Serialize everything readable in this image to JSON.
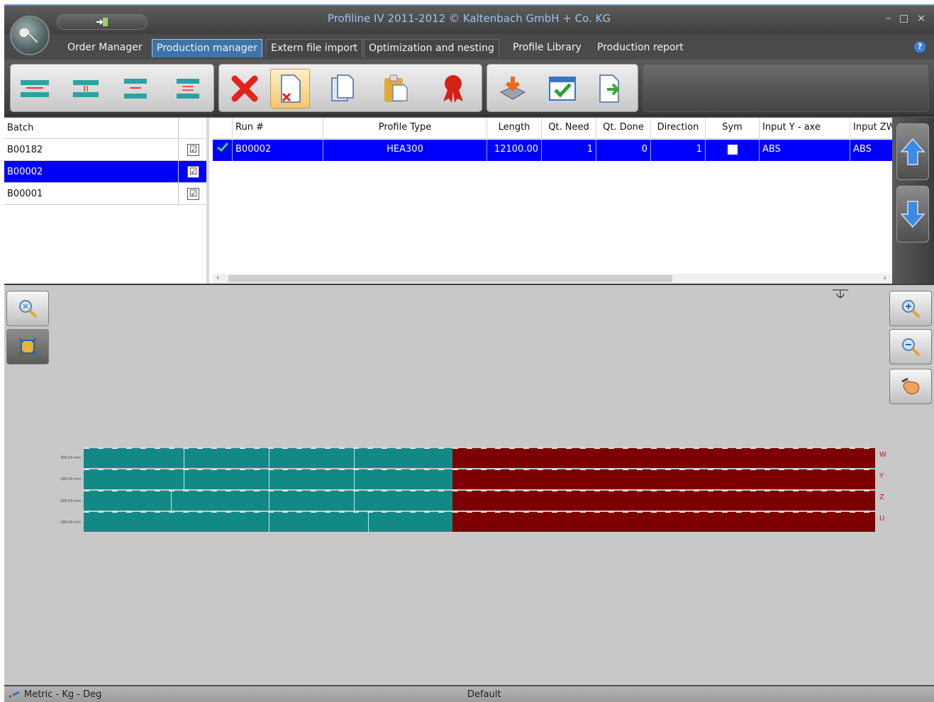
{
  "window": {
    "title": "Profiline IV 2011-2012 © Kaltenbach GmbH + Co. KG",
    "controls": {
      "minimize": "–",
      "maximize": "□",
      "close": "×"
    }
  },
  "tabs": [
    {
      "label": "Order Manager",
      "active": false
    },
    {
      "label": "Production manager",
      "active": true
    },
    {
      "label": "Extern file import",
      "active": false
    },
    {
      "label": "Optimization and nesting",
      "active": false
    },
    {
      "label": "Profile Library",
      "active": false
    },
    {
      "label": "Production report",
      "active": false
    }
  ],
  "batch_grid": {
    "header": "Batch",
    "rows": [
      {
        "name": "B00182",
        "checked": "☑"
      },
      {
        "name": "B00002",
        "checked": "☑"
      },
      {
        "name": "B00001",
        "checked": "☑"
      }
    ]
  },
  "run_grid": {
    "headers": [
      "Run #",
      "Profile Type",
      "Length",
      "Qt. Need",
      "Qt. Done",
      "Direction",
      "Sym",
      "Input  Y - axe",
      "Input ZW"
    ],
    "row": {
      "run": "B00002",
      "profile_type": "HEA300",
      "length": "12100.00",
      "qt_need": "1",
      "qt_done": "0",
      "direction": "1",
      "sym": "",
      "input_y": "ABS",
      "input_zw": "ABS"
    }
  },
  "drawing": {
    "faces": [
      "W",
      "Y",
      "Z",
      "U"
    ],
    "dims": [
      "300.00 mm",
      "290.00 mm",
      "300.00 mm",
      "290.00 mm"
    ],
    "done_fraction": 0.466
  },
  "status": {
    "units": "Metric - Kg - Deg",
    "profile": "Default"
  },
  "colors": {
    "selection": "#0000ff",
    "done": "#138986",
    "remaining": "#7c0002",
    "active_tab": "#3f74a8"
  }
}
